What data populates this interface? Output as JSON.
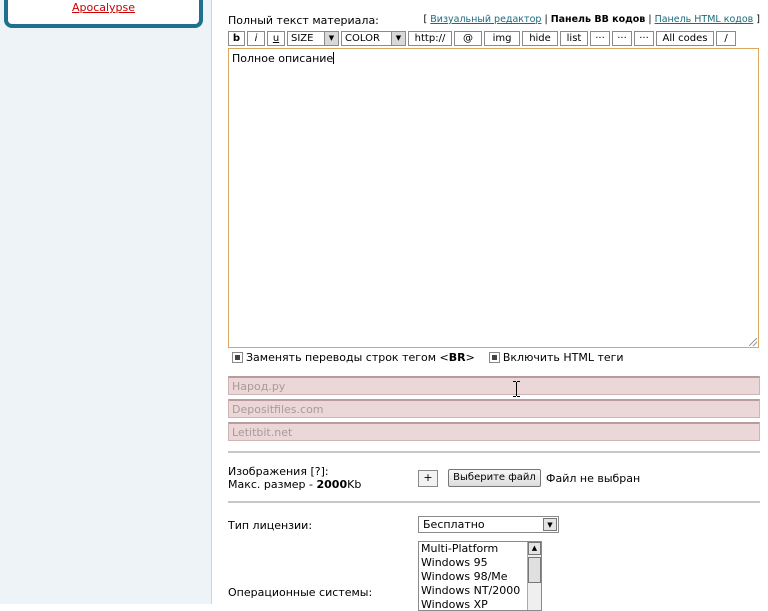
{
  "sidebar": {
    "link": "Apocalypse"
  },
  "editor": {
    "label": "Полный текст материала:",
    "modes": {
      "visual": "Визуальный редактор",
      "bbcode": "Панель BB кодов",
      "html": "Панель HTML кодов"
    },
    "toolbar": {
      "bold": "b",
      "italic": "i",
      "underline": "u",
      "size": "SIZE",
      "color": "COLOR",
      "url": "http://",
      "email": "@",
      "img": "img",
      "hide": "hide",
      "list": "list",
      "more1": "···",
      "more2": "···",
      "more3": "···",
      "all_codes": "All codes",
      "close": "/"
    },
    "content": "Полное описание",
    "option_br": "Заменять переводы строк тегом <BR>",
    "option_html": "Включить HTML теги"
  },
  "links": {
    "narod": "Народ.ру",
    "depositfiles": "Depositfiles.com",
    "letitbit": "Letitbit.net"
  },
  "images": {
    "label": "Изображения [?]:",
    "max_prefix": "Макс. размер - ",
    "max_value": "2000",
    "max_unit": "Kb",
    "add": "+",
    "choose_file": "Выберите файл",
    "no_file": "Файл не выбран"
  },
  "license": {
    "label": "Тип лицензии:",
    "value": "Бесплатно"
  },
  "os": {
    "label": "Операционные системы:",
    "options": [
      "Multi-Platform",
      "Windows 95",
      "Windows 98/Me",
      "Windows NT/2000",
      "Windows XP"
    ]
  }
}
